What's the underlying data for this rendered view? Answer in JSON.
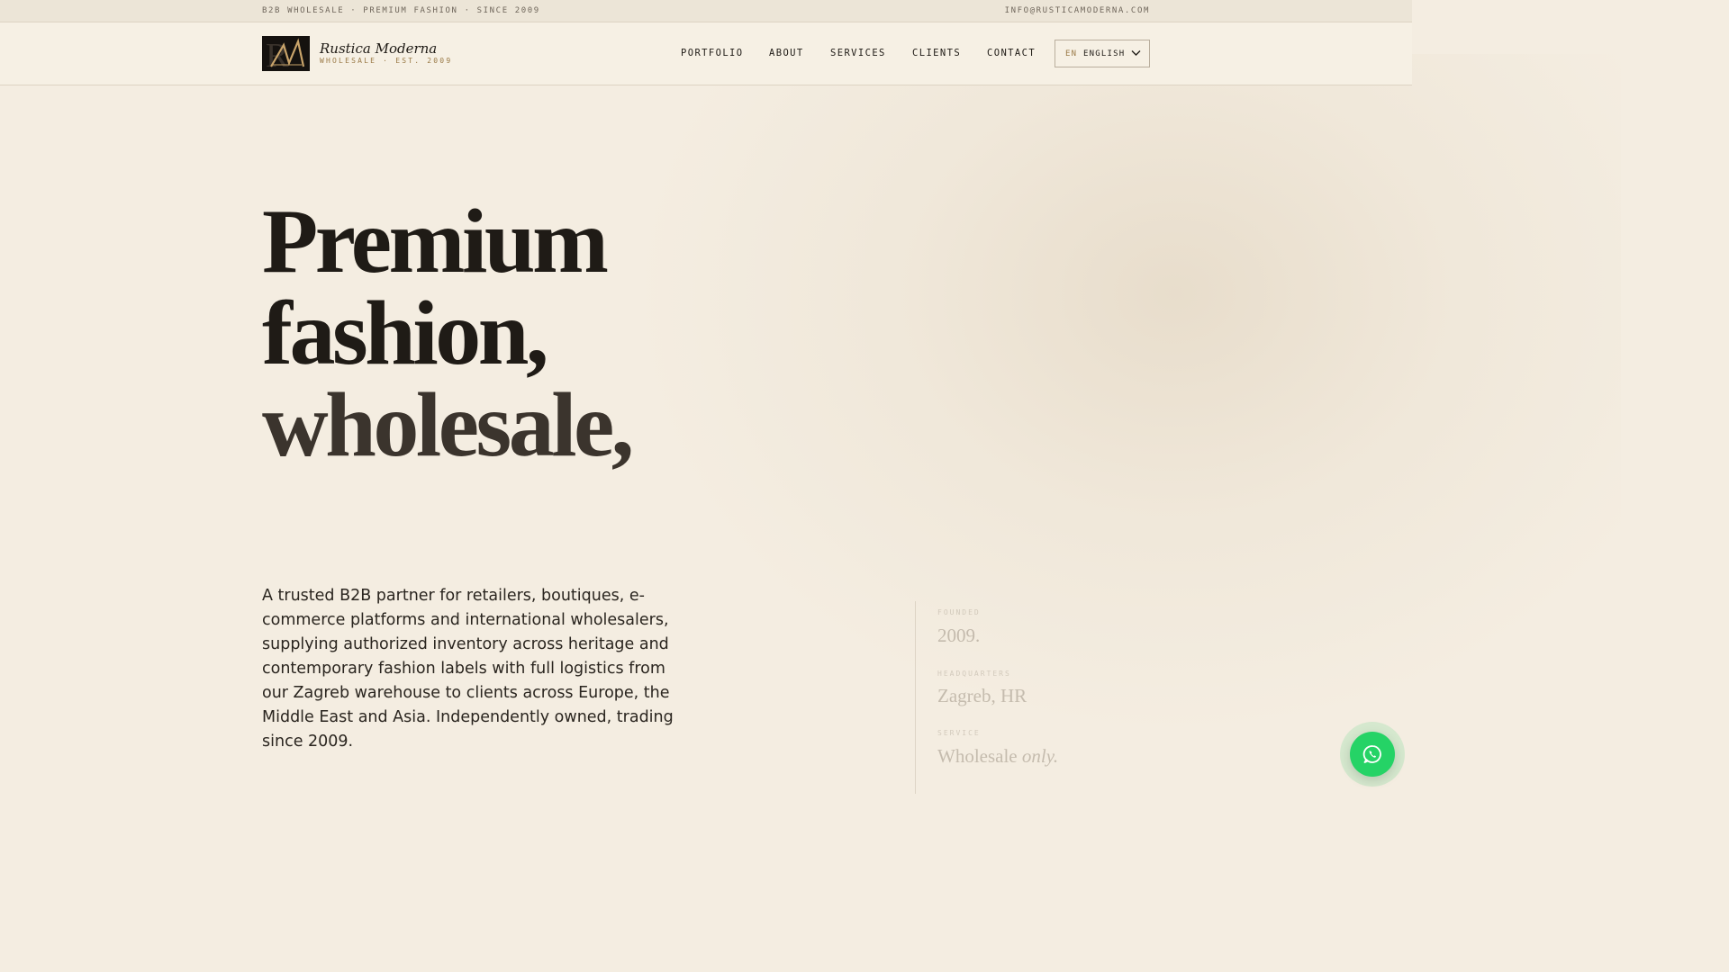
{
  "topbar": {
    "tagline": "B2B WHOLESALE · PREMIUM FASHION · SINCE 2009",
    "email": "INFO@RUSTICAMODERNA.COM"
  },
  "brand": {
    "name": "Rustica Moderna",
    "subtitle": "WHOLESALE · EST. 2009",
    "logo_icon": "rm-monogram-icon"
  },
  "nav": {
    "items": [
      "PORTFOLIO",
      "ABOUT",
      "SERVICES",
      "CLIENTS",
      "CONTACT"
    ],
    "language": {
      "code": "EN",
      "label": "ENGLISH",
      "icon": "chevron-down-icon"
    }
  },
  "hero": {
    "lines": [
      "Premium",
      "fashion,",
      "wholesale,"
    ],
    "intro": "A trusted B2B partner for retailers, boutiques, e-commerce platforms and international wholesalers, supplying authorized inventory across heritage and contemporary fashion labels with full logistics from our Zagreb warehouse to clients across Europe, the Middle East and Asia. Independently owned, trading since 2009."
  },
  "facts": [
    {
      "label": "FOUNDED",
      "value": "2009.",
      "value_em": ""
    },
    {
      "label": "HEADQUARTERS",
      "value": "Zagreb, HR",
      "value_em": ""
    },
    {
      "label": "SERVICE",
      "value": "Wholesale",
      "value_em": "only."
    }
  ],
  "whatsapp": {
    "icon": "whatsapp-icon",
    "color": "#25d366"
  },
  "colors": {
    "background": "#f4ede1",
    "accent": "#9a7a47",
    "text": "#1f1b16"
  }
}
